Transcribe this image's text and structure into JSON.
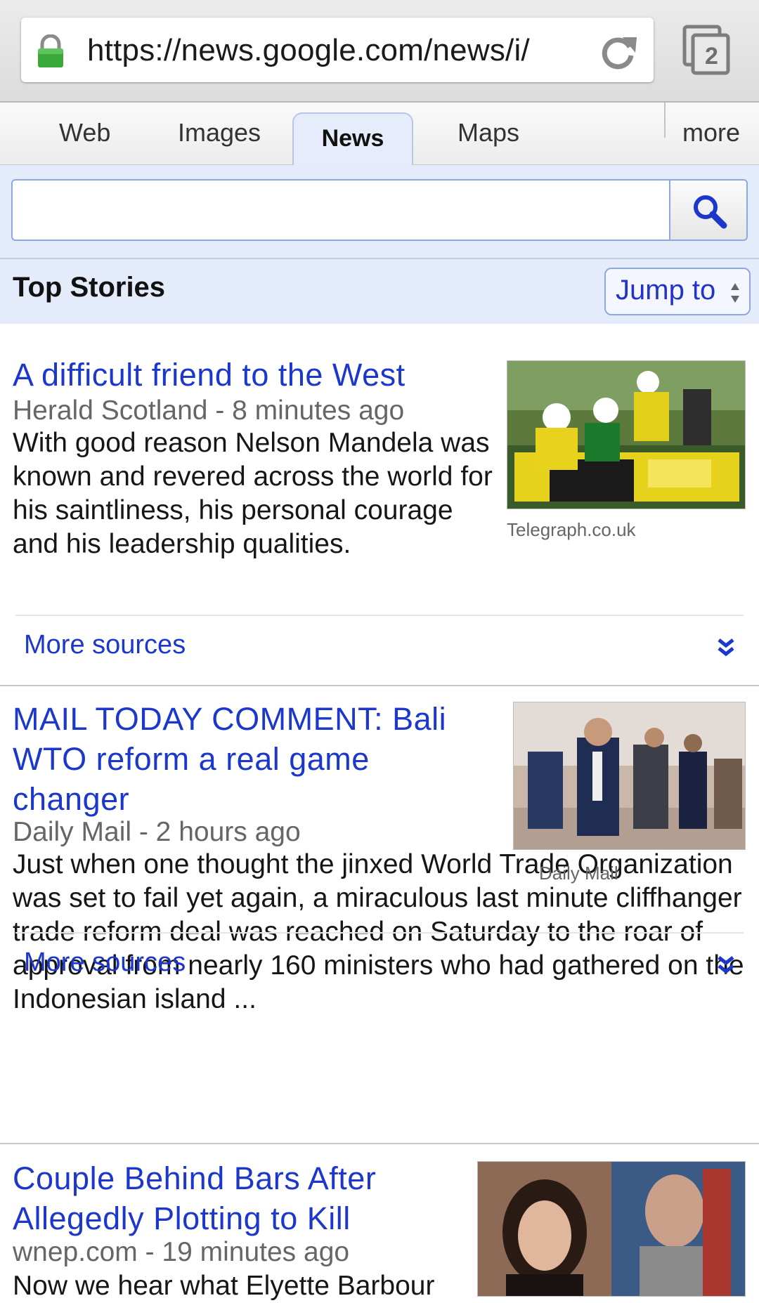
{
  "browser": {
    "url": "https://news.google.com/news/i/",
    "tab_count": "2"
  },
  "nav": {
    "tabs": [
      {
        "label": "Web"
      },
      {
        "label": "Images"
      },
      {
        "label": "News",
        "active": true
      },
      {
        "label": "Maps"
      },
      {
        "label": "more"
      }
    ]
  },
  "search": {
    "value": "",
    "placeholder": ""
  },
  "section": {
    "title": "Top Stories",
    "jump_label": "Jump to"
  },
  "stories": [
    {
      "headline": "A difficult friend to the West",
      "meta": "Herald Scotland - 8 minutes ago",
      "snippet": "With good reason Nelson Mandela was known and revered across the world for his saintliness, his personal courage and his leadership qualities.",
      "image_credit": "Telegraph.co.uk",
      "more_sources": "More sources"
    },
    {
      "headline": "MAIL TODAY COMMENT: Bali WTO reform a real game changer",
      "meta": "Daily Mail - 2 hours ago",
      "snippet": "Just when one thought the jinxed World Trade Organization was set to fail yet again, a miraculous last minute cliffhanger trade reform deal was reached on Saturday to the roar of approval from nearly 160 ministers who had gathered on the Indonesian island ...",
      "image_credit": "Daily Mail",
      "more_sources": "More sources"
    },
    {
      "headline": "Couple Behind Bars After Allegedly Plotting to Kill",
      "meta": "wnep.com - 19 minutes ago",
      "snippet": "Now we hear what Elyette Barbour"
    }
  ],
  "colors": {
    "link": "#1c38cc",
    "header_bg": "#e4ebfb",
    "lock_green": "#3aa83a"
  }
}
